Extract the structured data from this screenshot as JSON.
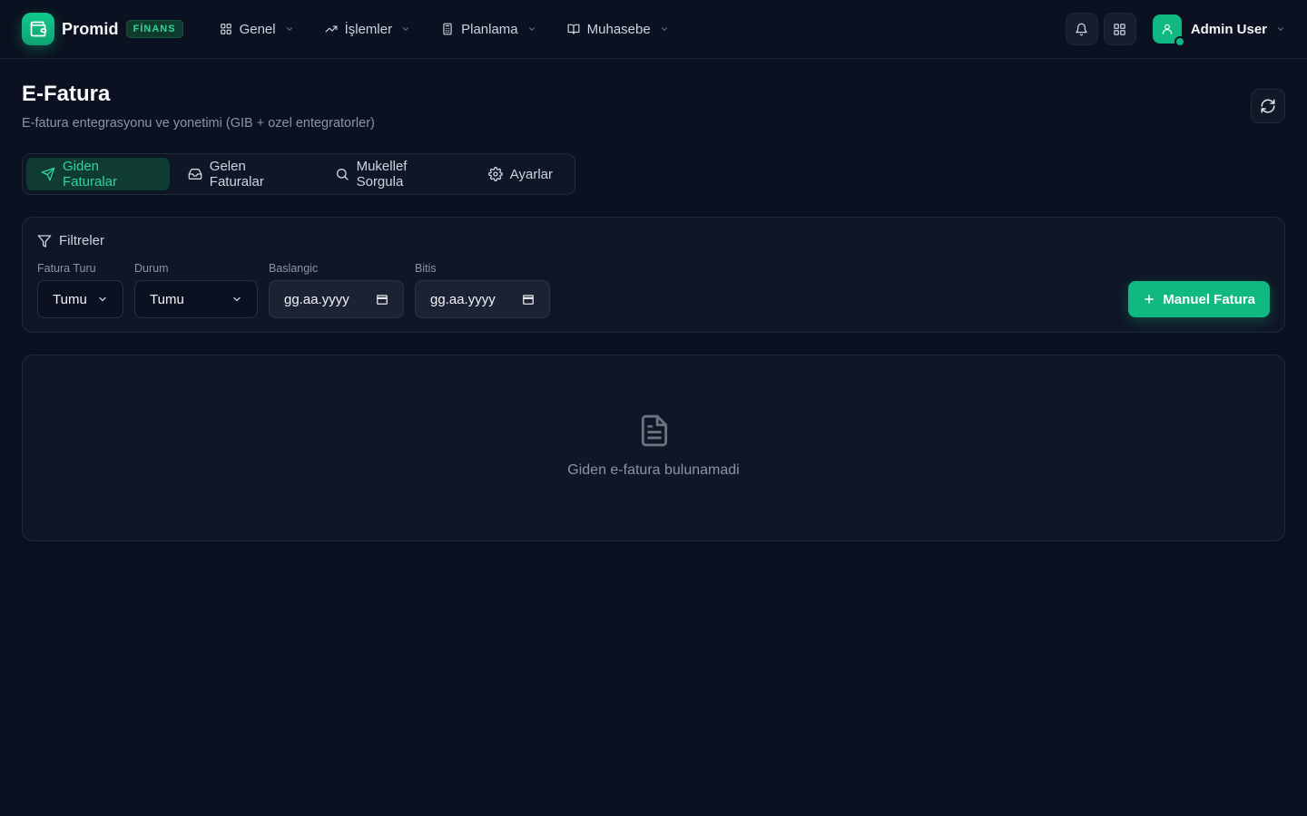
{
  "brand": {
    "name": "Promid",
    "badge": "FİNANS",
    "accent": "#10b981"
  },
  "nav": {
    "items": [
      {
        "label": "Genel",
        "icon": "grid-icon"
      },
      {
        "label": "İşlemler",
        "icon": "trending-up-icon"
      },
      {
        "label": "Planlama",
        "icon": "calculator-icon"
      },
      {
        "label": "Muhasebe",
        "icon": "book-open-icon"
      }
    ]
  },
  "header": {
    "user_name": "Admin User",
    "actions": [
      "bell-icon",
      "apps-grid-icon"
    ]
  },
  "page": {
    "title": "E-Fatura",
    "subtitle": "E-fatura entegrasyonu ve yonetimi (GIB + ozel entegratorler)"
  },
  "tabs": [
    {
      "label": "Giden Faturalar",
      "icon": "send-icon",
      "active": true
    },
    {
      "label": "Gelen Faturalar",
      "icon": "inbox-icon",
      "active": false
    },
    {
      "label": "Mukellef Sorgula",
      "icon": "search-icon",
      "active": false
    },
    {
      "label": "Ayarlar",
      "icon": "gear-icon",
      "active": false
    }
  ],
  "filters": {
    "title": "Filtreler",
    "invoice_type": {
      "label": "Fatura Turu",
      "value": "Tumu"
    },
    "status": {
      "label": "Durum",
      "value": "Tumu"
    },
    "start_date": {
      "label": "Baslangic",
      "placeholder": "gg.aa.yyyy"
    },
    "end_date": {
      "label": "Bitis",
      "placeholder": "gg.aa.yyyy"
    },
    "manual_button": "Manuel Fatura"
  },
  "empty_state": {
    "message": "Giden e-fatura bulunamadi",
    "icon": "file-text-icon"
  }
}
